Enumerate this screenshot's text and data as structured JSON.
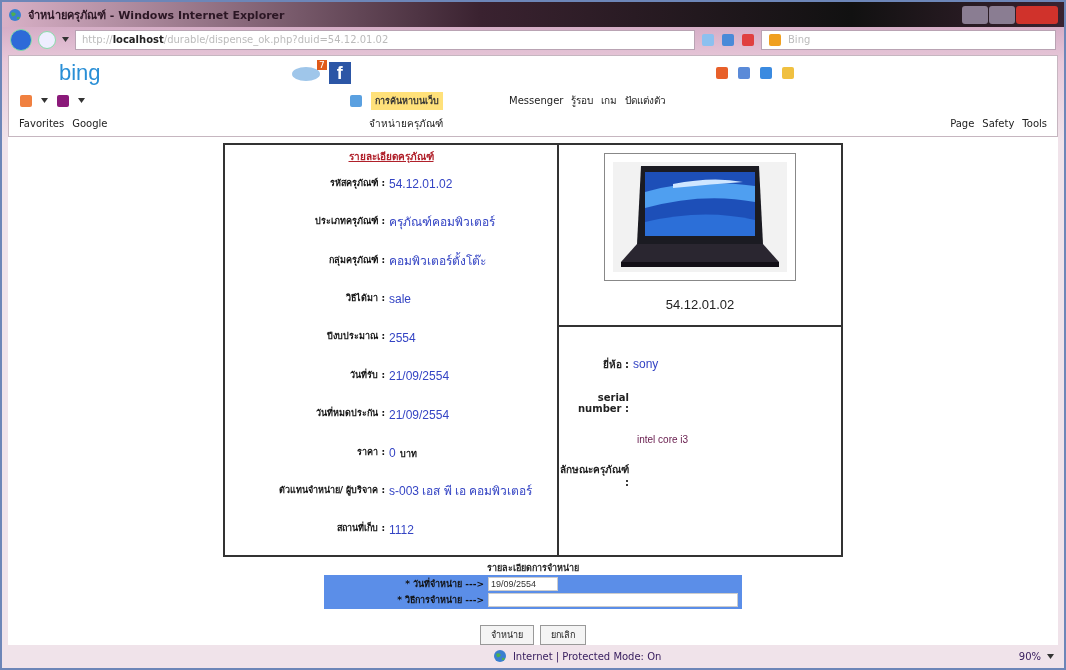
{
  "window": {
    "title": "จำหน่ายครุภัณฑ์ - Windows Internet Explorer"
  },
  "address_bar": {
    "url_prefix": "http://",
    "host": "localhost",
    "url_path": "/durable/dispense_ok.php?duid=54.12.01.02",
    "search_placeholder": "Bing"
  },
  "bing_bar": {
    "logo": "bing",
    "mail_count": "7",
    "facebook": "f"
  },
  "links_bar": {
    "search_label": "การค้นหาบนเว็บ",
    "items": [
      "Messenger",
      "รู้รอบ",
      "เกม",
      "ปัดแต่งตัว"
    ]
  },
  "favorites_bar": {
    "favorites": "Favorites",
    "google": "Google",
    "tab": "จำหน่ายครุภัณฑ์",
    "commands": [
      "Page",
      "Safety",
      "Tools"
    ]
  },
  "detail": {
    "heading": "รายละเอียดครุภัณฑ์",
    "fields": [
      {
        "label": "รหัสครุภัณฑ์ :",
        "value": "54.12.01.02"
      },
      {
        "label": "ประเภทครุภัณฑ์ :",
        "value": "ครุภัณฑ์คอมพิวเตอร์"
      },
      {
        "label": "กลุ่มครุภัณฑ์ :",
        "value": "คอมพิวเตอร์ตั้งโต๊ะ"
      },
      {
        "label": "วิธีได้มา :",
        "value": "sale"
      },
      {
        "label": "ปีงบประมาณ :",
        "value": "2554"
      },
      {
        "label": "วันที่รับ :",
        "value": "21/09/2554"
      },
      {
        "label": "วันที่หมดประกัน :",
        "value": "21/09/2554"
      },
      {
        "label": "ราคา :",
        "value": "0",
        "unit": "บาท"
      },
      {
        "label": "ตัวแทนจำหน่าย/ ผู้บริจาค :",
        "value": "s-003 เอส พี เอ คอมพิวเตอร์"
      },
      {
        "label": "สถานที่เก็บ :",
        "value": "1112"
      }
    ],
    "image_caption": "54.12.01.02",
    "brand": {
      "label": "ยี่ห้อ :",
      "value": "sony"
    },
    "serial": {
      "label": "serial number :"
    },
    "feature": {
      "label": "ลักษณะครุภัณฑ์ :",
      "value": "intel core i3"
    }
  },
  "disposal": {
    "heading": "รายละเอียดการจำหน่าย",
    "rows": [
      {
        "label": "* วันที่จำหน่าย --->",
        "value": "19/09/2554",
        "kind": "short"
      },
      {
        "label": "* วิธีการจำหน่าย --->",
        "kind": "long"
      }
    ],
    "buttons": [
      "จำหน่าย",
      "ยกเลิก"
    ]
  },
  "status_bar": {
    "text": "Internet | Protected Mode: On",
    "zoom": "90%"
  }
}
